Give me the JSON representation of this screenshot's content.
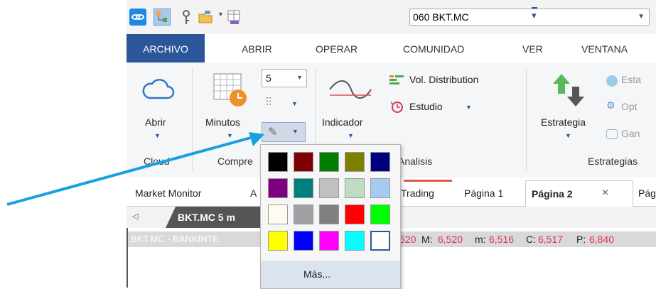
{
  "toolbar": {
    "symbol_value": "060 BKT.MC"
  },
  "menu": {
    "items": [
      "ARCHIVO",
      "ABRIR",
      "OPERAR",
      "COMUNIDAD",
      "VER",
      "VENTANA"
    ]
  },
  "ribbon": {
    "abrir_label": "Abrir",
    "minutos_label": "Minutos",
    "interval_value": "5",
    "indicador_label": "Indicador",
    "vol_distribution_label": "Vol. Distribution",
    "estudio_label": "Estudio",
    "estrategia_label": "Estrategia",
    "esta_label": "Esta",
    "opt_label": "Opt",
    "gan_label": "Gan",
    "group_cloud": "Cloud",
    "group_compre": "Compre",
    "group_analisis": "Analisis",
    "group_estrategias": "Estrategias"
  },
  "page_tabs": {
    "market_monitor": "Market Monitor",
    "a_partial": "A",
    "trading": "Trading",
    "pagina1": "Página 1",
    "pagina2": "Página 2",
    "close_glyph": "×",
    "pagina_partial": "Pági"
  },
  "chart": {
    "tab_label": "BKT.MC 5 m",
    "header_name": "BKT.MC - BANKINTE",
    "ohlc": {
      "o_tail": "520",
      "m_label": "M:",
      "m_value": "6,520",
      "min_label": "m:",
      "min_value": "6,516",
      "c_label": "C:",
      "c_value": "6,517",
      "p_label": "P:",
      "p_value": "6,840"
    }
  },
  "color_popup": {
    "more_label": "Más...",
    "colors": [
      "#000000",
      "#7f0000",
      "#007f00",
      "#7f7f00",
      "#00007f",
      "#7f007f",
      "#007f7f",
      "#c0c0c0",
      "#c0dcc0",
      "#a6caf0",
      "#fffbf0",
      "#a0a0a4",
      "#808080",
      "#ff0000",
      "#00ff00",
      "#ffff00",
      "#0000ff",
      "#ff00ff",
      "#00ffff",
      "#ffffff"
    ]
  },
  "accent": {
    "ribbon_blue": "#2b579a",
    "arrow_blue": "#1aa0e0",
    "value_red": "#e0334f"
  }
}
